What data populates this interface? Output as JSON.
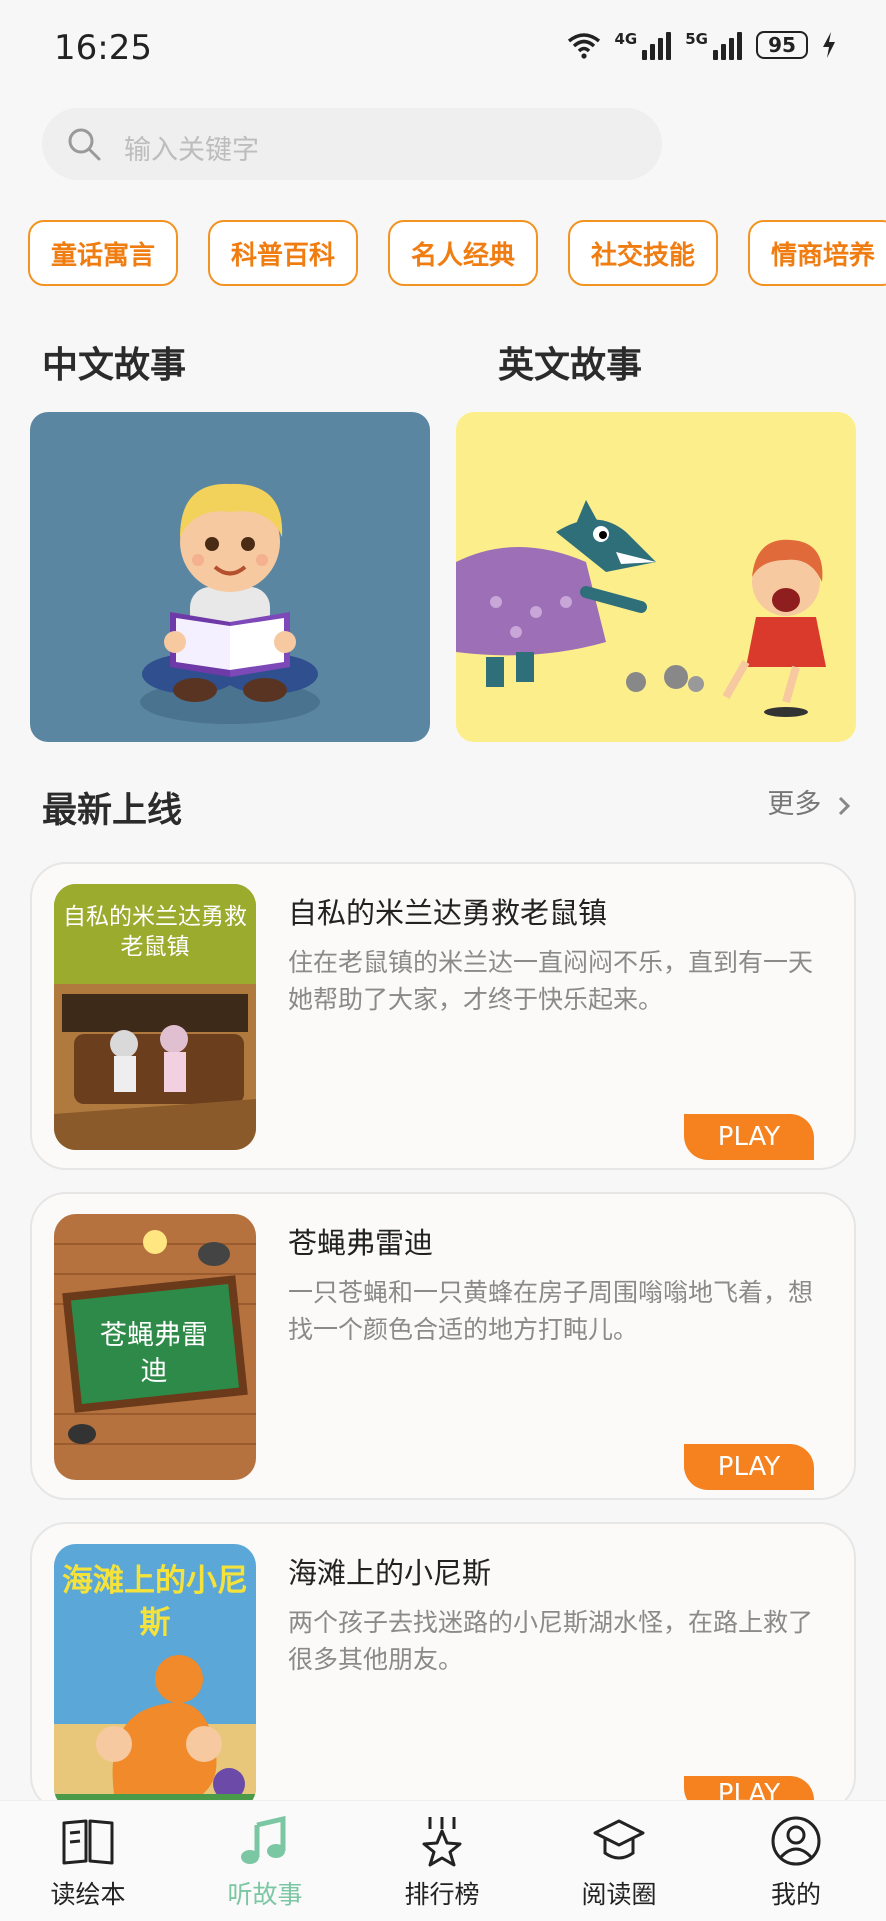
{
  "status_bar": {
    "time": "16:25",
    "net1": "4G",
    "net2": "5G",
    "battery": "95"
  },
  "search": {
    "placeholder": "输入关键字"
  },
  "categories": [
    "童话寓言",
    "科普百科",
    "名人经典",
    "社交技能",
    "情商培养"
  ],
  "sections": {
    "chinese": "中文故事",
    "english": "英文故事",
    "latest": "最新上线",
    "more": "更多"
  },
  "stories": [
    {
      "title": "自私的米兰达勇救老鼠镇",
      "desc": "住在老鼠镇的米兰达一直闷闷不乐，直到有一天她帮助了大家，才终于快乐起来。",
      "cover_text": "自私的米兰达勇救老鼠镇",
      "play": "PLAY"
    },
    {
      "title": "苍蝇弗雷迪",
      "desc": "一只苍蝇和一只黄蜂在房子周围嗡嗡地飞着，想找一个颜色合适的地方打盹儿。",
      "cover_text": "苍蝇弗雷迪",
      "play": "PLAY"
    },
    {
      "title": "海滩上的小尼斯",
      "desc": "两个孩子去找迷路的小尼斯湖水怪，在路上救了很多其他朋友。",
      "cover_text": "海滩上的小尼斯",
      "play": "PLAY"
    }
  ],
  "tabs": [
    "读绘本",
    "听故事",
    "排行榜",
    "阅读圈",
    "我的"
  ],
  "colors": {
    "accent": "#f5821f",
    "category_border": "#f29322",
    "active_tab": "#7cc7a3"
  }
}
